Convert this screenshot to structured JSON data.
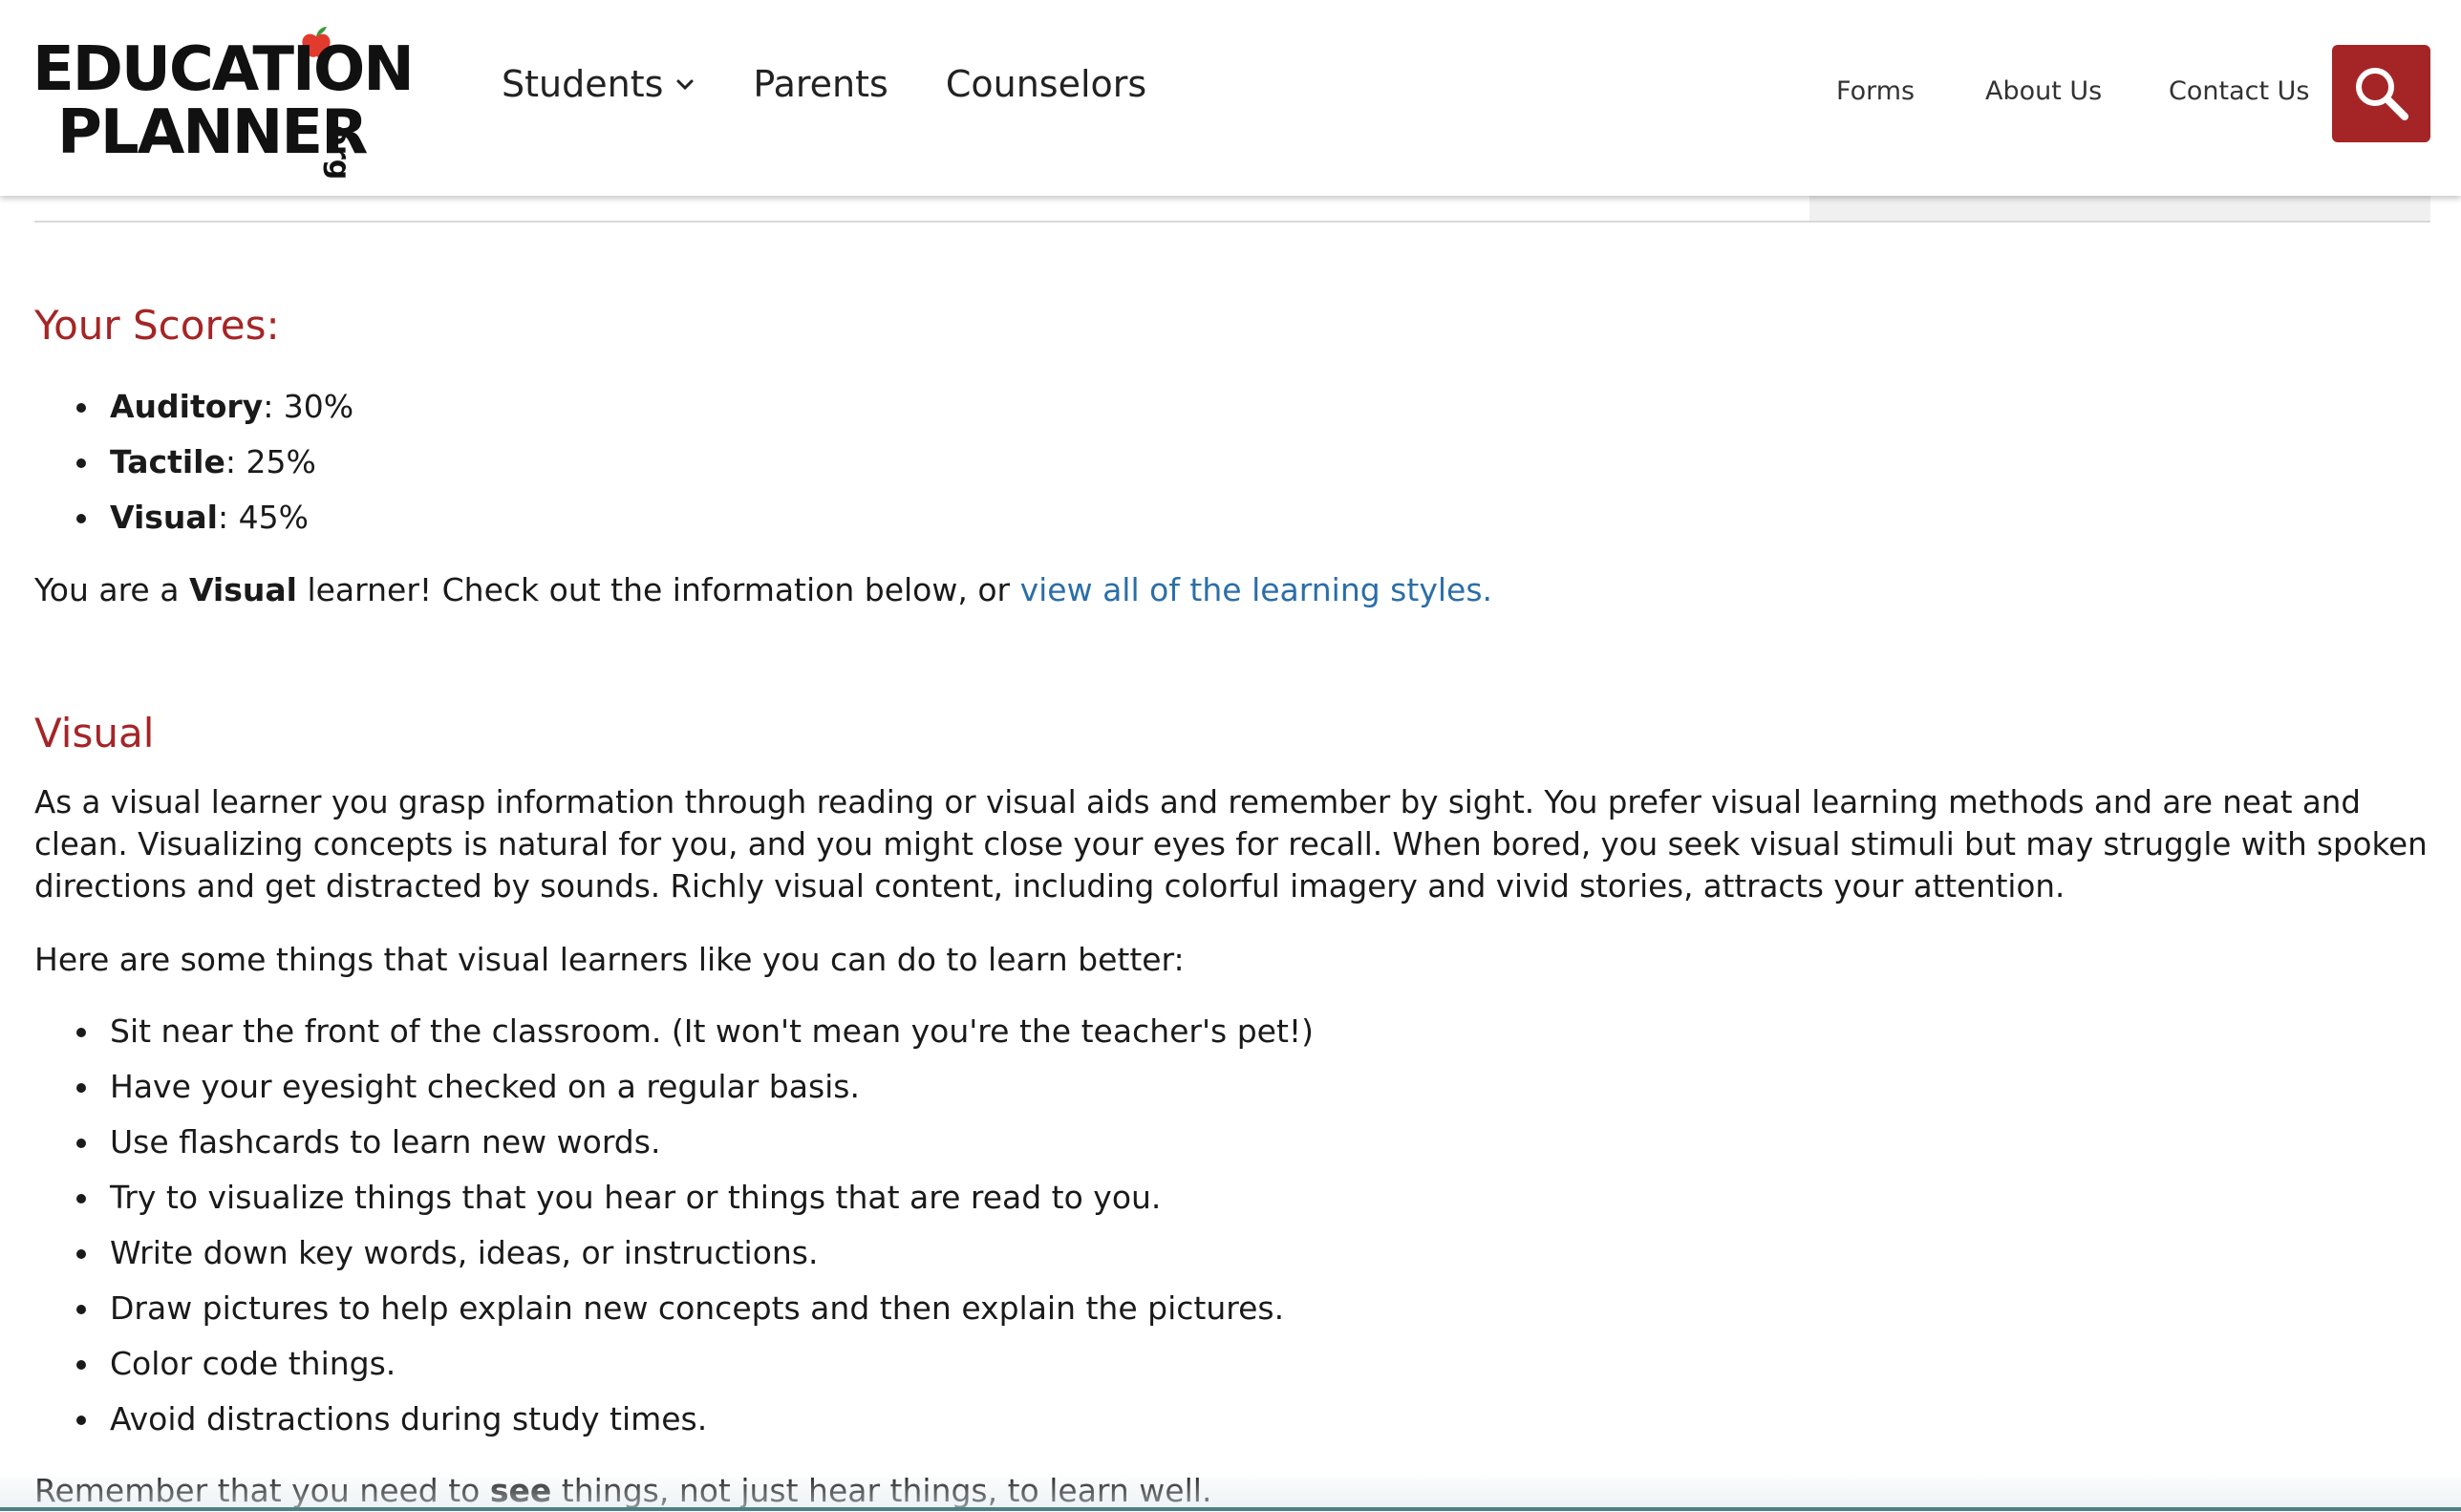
{
  "header": {
    "logo": {
      "line1": "EDUCATION",
      "line2": "PLANNER",
      "suffix": ".org"
    },
    "primary_nav": [
      {
        "label": "Students",
        "has_dropdown": true
      },
      {
        "label": "Parents"
      },
      {
        "label": "Counselors"
      }
    ],
    "secondary_nav": [
      {
        "label": "Forms"
      },
      {
        "label": "About Us"
      },
      {
        "label": "Contact Us"
      }
    ],
    "search_icon": "search-icon",
    "accent_color": "#a52526"
  },
  "scores": {
    "heading": "Your Scores:",
    "items": [
      {
        "label": "Auditory",
        "value": ": 30%"
      },
      {
        "label": "Tactile",
        "value": ": 25%"
      },
      {
        "label": "Visual",
        "value": ": 45%"
      }
    ],
    "result": {
      "prefix": "You are a ",
      "style": "Visual",
      "middle": " learner! Check out the information below, or ",
      "link": "view all of the learning styles."
    }
  },
  "visual": {
    "heading": "Visual",
    "description": "As a visual learner you grasp information through reading or visual aids and remember by sight. You prefer visual learning methods and are neat and clean. Visualizing concepts is natural for you, and you might close your eyes for recall. When bored, you seek visual stimuli but may struggle with spoken directions and get distracted by sounds. Richly visual content, including colorful imagery and vivid stories, attracts your attention.",
    "intro": "Here are some things that visual learners like you can do to learn better:",
    "tips": [
      "Sit near the front of the classroom. (It won't mean you're the teacher's pet!)",
      "Have your eyesight checked on a regular basis.",
      "Use flashcards to learn new words.",
      "Try to visualize things that you hear or things that are read to you.",
      "Write down key words, ideas, or instructions.",
      "Draw pictures to help explain new concepts and then explain the pictures.",
      "Color code things.",
      "Avoid distractions during study times."
    ],
    "closing": {
      "prefix": "Remember that you need to ",
      "emphasis": "see",
      "suffix": " things, not just hear things, to learn well."
    }
  },
  "colors": {
    "heading": "#a52526",
    "link": "#2b6ea8",
    "text": "#1a1a1a"
  }
}
